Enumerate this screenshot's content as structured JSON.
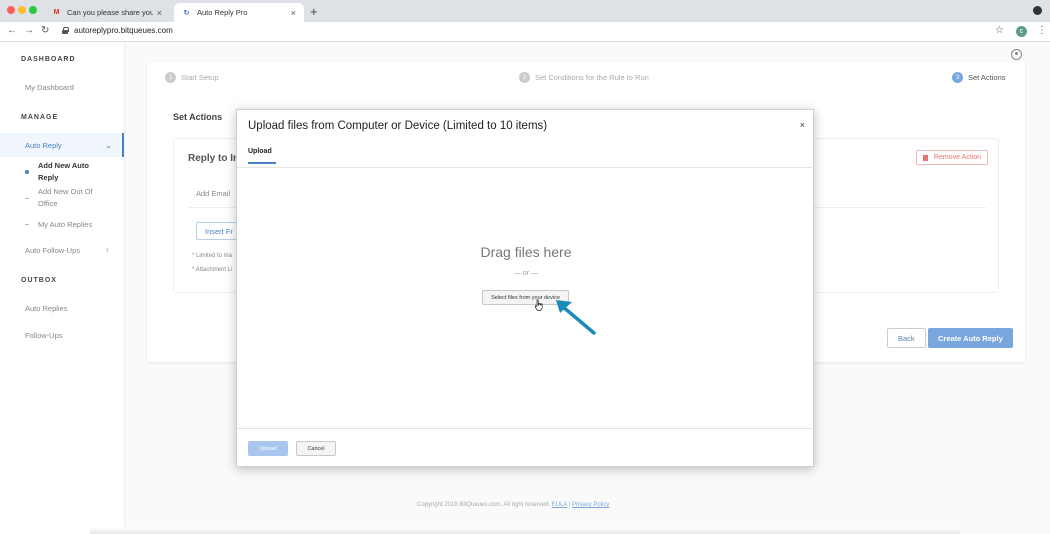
{
  "browser": {
    "tabs": [
      {
        "label": "Can you please share your ma",
        "icon": "gmail-icon",
        "active": false
      },
      {
        "label": "Auto Reply Pro",
        "icon": "app-icon",
        "active": true
      }
    ],
    "new_tab": "+",
    "url": "autoreplypro.bitqueues.com",
    "profile_initial": "c"
  },
  "sidebar": {
    "dashboard_heading": "DASHBOARD",
    "my_dashboard": "My Dashboard",
    "manage_heading": "MANAGE",
    "auto_reply": "Auto Reply",
    "add_new_auto_reply": "Add New Auto Reply",
    "add_new_out_of_office": "Add New Out Of Office",
    "my_auto_replies": "My Auto Replies",
    "auto_follow_ups": "Auto Follow-Ups",
    "outbox_heading": "OUTBOX",
    "auto_replies": "Auto Replies",
    "follow_ups": "Follow-Ups"
  },
  "steps": [
    {
      "num": "1",
      "label": "Start Setup"
    },
    {
      "num": "2",
      "label": "Set Conditions for the Rule to Run"
    },
    {
      "num": "3",
      "label": "Set Actions"
    }
  ],
  "main": {
    "set_actions_title": "Set Actions",
    "reply_title": "Reply to In",
    "remove_action": "Remove Action",
    "add_email": "Add Email",
    "insert_btn": "Insert Fr",
    "note1": "* Limited to ma",
    "note2": "* Attachment Li",
    "back": "Back",
    "create": "Create Auto Reply"
  },
  "footer": {
    "copyright": "Copyright 2018 BitQueues.com, All right reserved.",
    "eula": "EULA",
    "separator": "|",
    "privacy": "Privacy Policy"
  },
  "modal": {
    "title": "Upload files from Computer or Device (Limited to 10 items)",
    "close": "×",
    "tab": "Upload",
    "drag_text": "Drag files here",
    "or_text": "— or —",
    "select_btn": "Select files from your device",
    "upload_btn": "Upload",
    "cancel_btn": "Cancel"
  },
  "colors": {
    "accent": "#4a7fc4",
    "accent_light": "#7aa6de",
    "danger": "#e57373",
    "arrow": "#1a8bb8"
  }
}
